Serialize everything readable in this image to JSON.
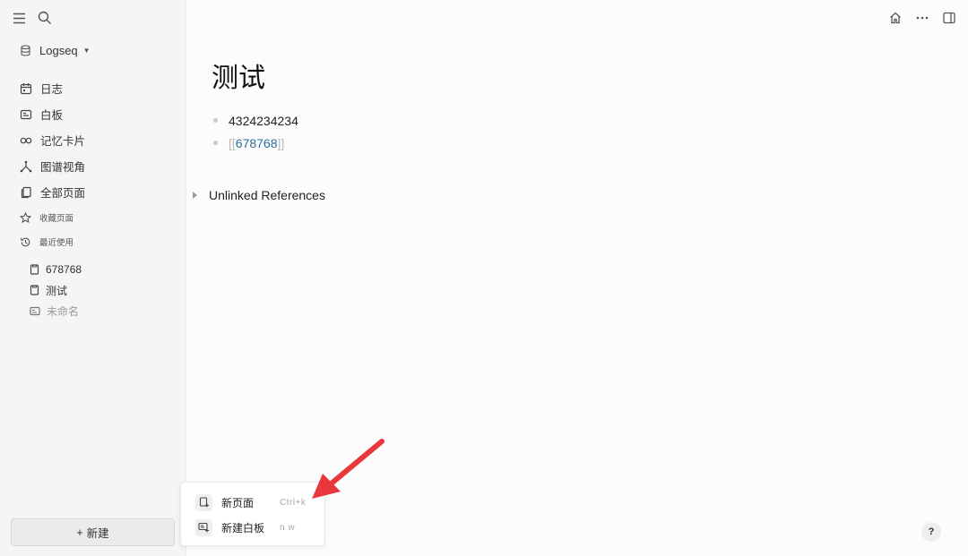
{
  "sidebar": {
    "graph_name": "Logseq",
    "nav": [
      {
        "label": "日志",
        "icon": "calendar-icon"
      },
      {
        "label": "白板",
        "icon": "whiteboard-icon"
      },
      {
        "label": "记忆卡片",
        "icon": "infinity-icon"
      },
      {
        "label": "图谱视角",
        "icon": "graph-icon"
      },
      {
        "label": "全部页面",
        "icon": "pages-icon"
      }
    ],
    "favorites_label": "收藏页面",
    "recent_label": "最近使用",
    "recent": [
      {
        "label": "678768",
        "icon": "page-icon"
      },
      {
        "label": "测试",
        "icon": "page-icon"
      },
      {
        "label": "未命名",
        "icon": "whiteboard-icon"
      }
    ],
    "new_button": "新建",
    "new_plus": "+"
  },
  "page": {
    "title": "测试",
    "blocks": [
      {
        "text": "4324234234"
      },
      {
        "open": "[[",
        "link": "678768",
        "close": "]]"
      }
    ],
    "unlinked_label": "Unlinked References"
  },
  "new_menu": {
    "items": [
      {
        "label": "新页面",
        "shortcut": "Ctrl+k"
      },
      {
        "label": "新建白板",
        "shortcut": "n w"
      }
    ]
  },
  "help_label": "?",
  "annotation": {
    "arrow_color": "#e8383b"
  }
}
